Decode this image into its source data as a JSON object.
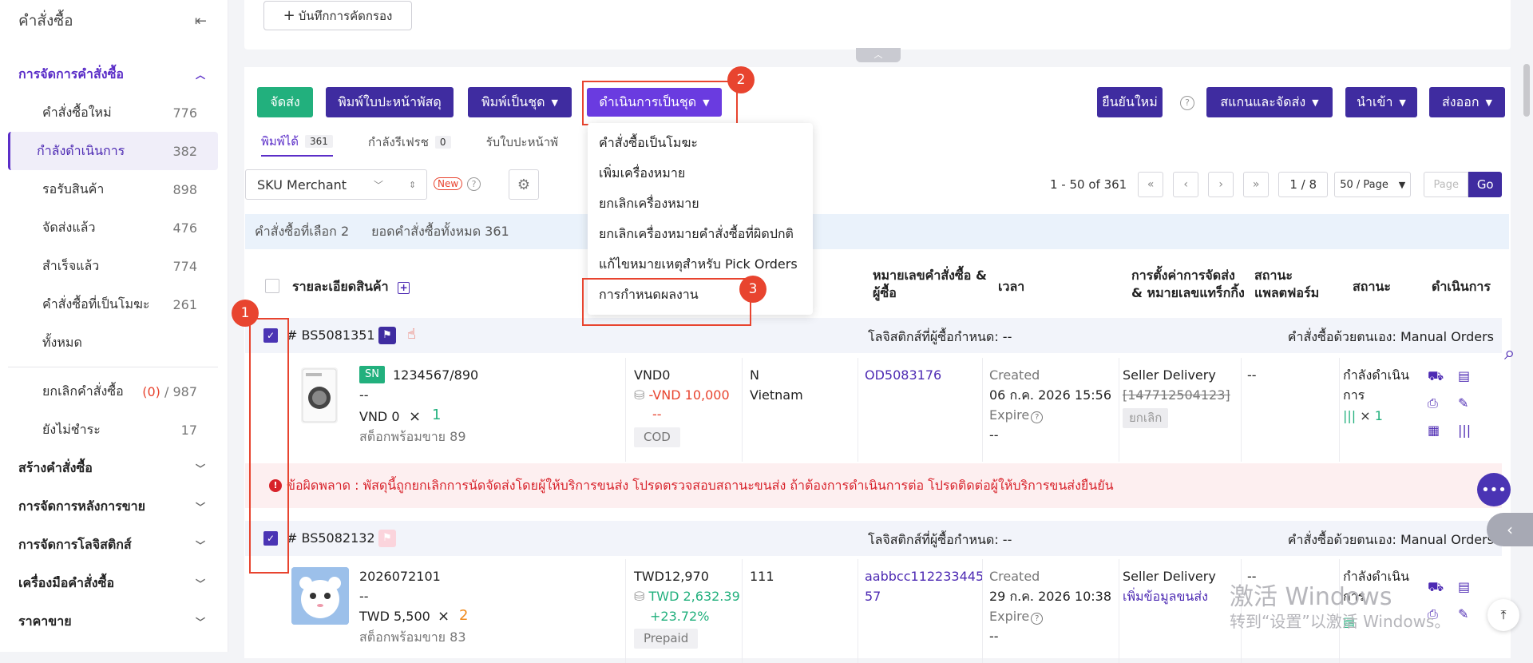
{
  "sidebar": {
    "title": "คำสั่งซื้อ",
    "section_active": "การจัดการคำสั่งซื้อ",
    "items": [
      {
        "label": "คำสั่งซื้อใหม่",
        "count": "776"
      },
      {
        "label": "กำลังดำเนินการ",
        "count": "382"
      },
      {
        "label": "รอรับสินค้า",
        "count": "898"
      },
      {
        "label": "จัดส่งแล้ว",
        "count": "476"
      },
      {
        "label": "สำเร็จแล้ว",
        "count": "774"
      },
      {
        "label": "คำสั่งซื้อที่เป็นโมฆะ",
        "count": "261"
      },
      {
        "label": "ทั้งหมด",
        "count": ""
      }
    ],
    "cancel": {
      "label": "ยกเลิกคำสั่งซื้อ",
      "count_red": "(0)",
      "count_total": "987"
    },
    "unpaid": {
      "label": "ยังไม่ชำระ",
      "count": "17"
    },
    "sections": [
      "สร้างคำสั่งซื้อ",
      "การจัดการหลังการขาย",
      "การจัดการโลจิสติกส์",
      "เครื่องมือคำสั่งซื้อ",
      "ราคาขาย"
    ]
  },
  "top": {
    "save_filter": "บันทึกการคัดกรอง"
  },
  "toolbar": {
    "ship": "จัดส่ง",
    "print_label": "พิมพ์ใบปะหน้าพัสดุ",
    "print_batch": "พิมพ์เป็นชุด",
    "batch_ops": "ดำเนินการเป็นชุด",
    "reconfirm": "ยืนยันใหม่",
    "scan_ship": "สแกนและจัดส่ง",
    "import": "นำเข้า",
    "export": "ส่งออก"
  },
  "markers": {
    "m1": "1",
    "m2": "2",
    "m3": "3"
  },
  "tabs": [
    {
      "label": "พิมพ์ได้",
      "count": "361"
    },
    {
      "label": "กำลังรีเฟรช",
      "count": "0"
    },
    {
      "label": "รับใบปะหน้าพั",
      "count": ""
    }
  ],
  "filter": {
    "select": "SKU Merchant",
    "new_badge": "New"
  },
  "pagination": {
    "range": "1 - 50 of 361",
    "page_of": "1 / 8",
    "per_page": "50 / Page",
    "page_placeholder": "Page",
    "go": "Go"
  },
  "info": {
    "selected": "คำสั่งซื้อที่เลือก 2",
    "total": "ยอดคำสั่งซื้อทั้งหมด 361"
  },
  "columns": {
    "product": "รายละเอียดสินค้า",
    "order_no": "หมายเลขคำสั่งซื้อ &",
    "order_no2": "ผู้ซื้อ",
    "time": "เวลา",
    "ship_setting": "การตั้งค่าการจัดส่ง",
    "ship_setting2": "& หมายเลขแทร็กกิ้ง",
    "platform_status": "สถานะ",
    "platform_status2": "แพลตฟอร์ม",
    "status": "สถานะ",
    "actions": "ดำเนินการ"
  },
  "dropdown": [
    "คำสั่งซื้อเป็นโมฆะ",
    "เพิ่มเครื่องหมาย",
    "ยกเลิกเครื่องหมาย",
    "ยกเลิกเครื่องหมายคำสั่งซื้อที่ผิดปกติ",
    "แก้ไขหมายเหตุสำหรับ Pick Orders",
    "การกำหนดผลงาน"
  ],
  "orders": [
    {
      "id": "# BS5081351",
      "logistics": "โลจิสติกส์ที่ผู้ซื้อกำหนด: --",
      "manual": "คำสั่งซื้อด้วยตนเอง: Manual Orders",
      "sn": "SN",
      "sku": "1234567/890",
      "dash": "--",
      "price": "VND 0",
      "times": "×",
      "qty": "1",
      "stock": "สต็อกพร้อมขาย 89",
      "amount": "VND0",
      "amount2": "-VND 10,000",
      "amount3": "--",
      "pay": "COD",
      "buyer1": "N",
      "buyer2": "Vietnam",
      "order_no": "OD5083176",
      "created": "Created",
      "date": "06 ก.ค. 2026 15:56",
      "expire": "Expire",
      "expire_val": "--",
      "carrier": "Seller Delivery",
      "tracking": "[147712504123]",
      "cancel": "ยกเลิก",
      "pstatus": "--",
      "status1": "กำลังดำเนิน",
      "status2": "การ",
      "scan_qty": "× 1"
    },
    {
      "id": "# BS5082132",
      "logistics": "โลจิสติกส์ที่ผู้ซื้อกำหนด: --",
      "manual": "คำสั่งซื้อด้วยตนเอง: Manual Orders",
      "sku": "2026072101",
      "dash": "--",
      "price": "TWD 5,500",
      "times": "×",
      "qty": "2",
      "stock": "สต็อกพร้อมขาย 83",
      "amount": "TWD12,970",
      "amount2": "TWD 2,632.39",
      "amount3": "+23.72%",
      "pay": "Prepaid",
      "buyer1": "111",
      "order_no": "aabbcc112233445",
      "order_no2": "57",
      "created": "Created",
      "date": "29 ก.ค. 2026 10:38",
      "expire": "Expire",
      "expire_val": "--",
      "carrier": "Seller Delivery",
      "add_logistics": "เพิ่มข้อมูลขนส่ง",
      "pstatus": "--",
      "status1": "กำลังดำเนิน",
      "status2": "การ"
    }
  ],
  "error": "ข้อผิดพลาด : พัสดุนี้ถูกยกเลิกการนัดจัดส่งโดยผู้ให้บริการขนส่ง โปรดตรวจสอบสถานะขนส่ง ถ้าต้องการดำเนินการต่อ โปรดติดต่อผู้ให้บริการขนส่งยืนยัน",
  "watermark": {
    "line1": "激活 Windows",
    "line2": "转到“设置”以激活 Windows。"
  },
  "colors": {
    "primary": "#3f2ca0",
    "accent": "#6a3be0",
    "green": "#22b07d",
    "marker": "#e8442f"
  }
}
